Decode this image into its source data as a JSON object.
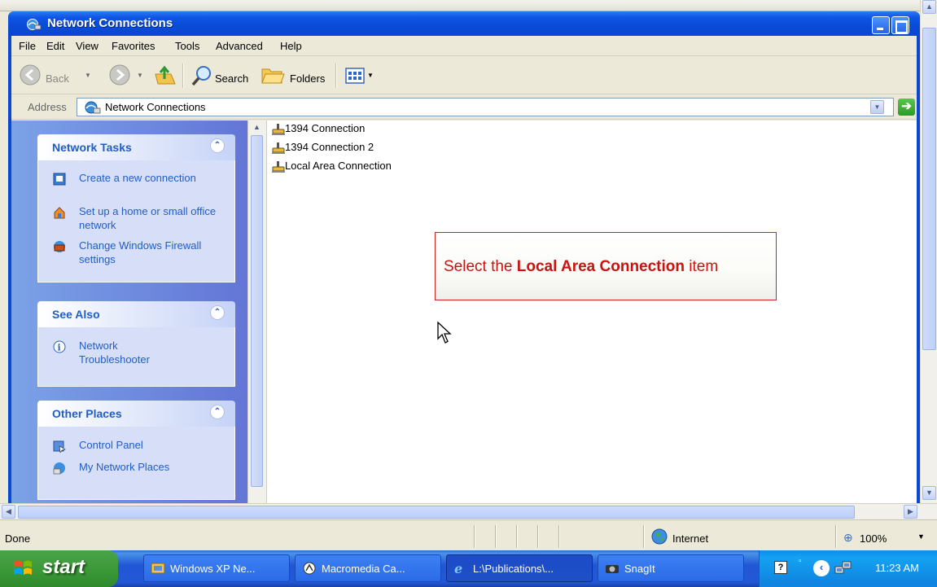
{
  "window": {
    "title": "Network Connections"
  },
  "menu": [
    "File",
    "Edit",
    "View",
    "Favorites",
    "Tools",
    "Advanced",
    "Help"
  ],
  "toolbar": {
    "back": "Back",
    "search": "Search",
    "folders": "Folders"
  },
  "address": {
    "label": "Address",
    "value": "Network Connections"
  },
  "panels": {
    "network_tasks": {
      "title": "Network Tasks",
      "items": [
        "Create a new connection",
        "Set up a home or small office network",
        "Change Windows Firewall settings"
      ]
    },
    "see_also": {
      "title": "See Also",
      "items": [
        "Network Troubleshooter"
      ]
    },
    "other_places": {
      "title": "Other Places",
      "items": [
        "Control Panel",
        "My Network Places"
      ]
    }
  },
  "connections": [
    "1394 Connection",
    "1394 Connection 2",
    "Local Area Connection"
  ],
  "callout": {
    "prefix": "Select the ",
    "emphasis": "Local Area Connection",
    "suffix": " item"
  },
  "status": {
    "text": "Done",
    "zone": "Internet",
    "zoom": "100%"
  },
  "taskbar": {
    "start": "start",
    "buttons": [
      "Windows XP Ne...",
      "Macromedia Ca...",
      "L:\\Publications\\...",
      "SnagIt"
    ],
    "clock": "11:23 AM"
  },
  "colors": {
    "title_bar": "#0a4bd8",
    "task_link": "#215dc6",
    "callout_text": "#cc1111",
    "start_button": "#3c9a39"
  },
  "icons": [
    "network-connections-icon",
    "back-arrow-icon",
    "forward-arrow-icon",
    "up-folder-icon",
    "search-icon",
    "folders-icon",
    "views-icon",
    "go-arrow-icon",
    "network-cable-icon",
    "globe-icon",
    "zoom-icon",
    "windows-flag-icon",
    "clock-icon"
  ]
}
